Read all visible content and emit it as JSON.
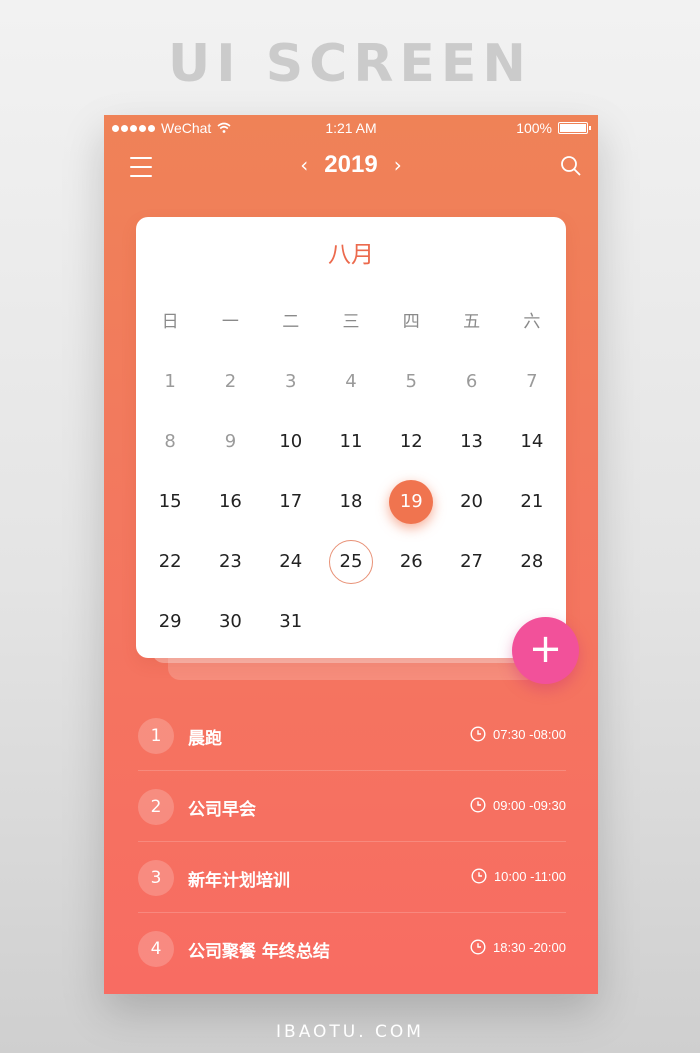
{
  "showcase": {
    "title": "UI SCREEN",
    "footer": "IBAOTU. COM"
  },
  "status_bar": {
    "carrier": "WeChat",
    "time": "1:21 AM",
    "battery": "100%"
  },
  "nav": {
    "year": "2019",
    "prev": "‹",
    "next": "›",
    "icons": [
      "menu-icon",
      "search-icon"
    ]
  },
  "calendar": {
    "month": "八月",
    "weekdays": [
      "日",
      "一",
      "二",
      "三",
      "四",
      "五",
      "六"
    ],
    "days": [
      {
        "d": "1",
        "muted": true
      },
      {
        "d": "2",
        "muted": true
      },
      {
        "d": "3",
        "muted": true
      },
      {
        "d": "4",
        "muted": true
      },
      {
        "d": "5",
        "muted": true
      },
      {
        "d": "6",
        "muted": true
      },
      {
        "d": "7",
        "muted": true
      },
      {
        "d": "8",
        "muted": true
      },
      {
        "d": "9",
        "muted": true
      },
      {
        "d": "10"
      },
      {
        "d": "11"
      },
      {
        "d": "12"
      },
      {
        "d": "13"
      },
      {
        "d": "14"
      },
      {
        "d": "15"
      },
      {
        "d": "16"
      },
      {
        "d": "17"
      },
      {
        "d": "18"
      },
      {
        "d": "19",
        "selected": true
      },
      {
        "d": "20"
      },
      {
        "d": "21"
      },
      {
        "d": "22"
      },
      {
        "d": "23"
      },
      {
        "d": "24"
      },
      {
        "d": "25",
        "ring": true
      },
      {
        "d": "26"
      },
      {
        "d": "27"
      },
      {
        "d": "28"
      },
      {
        "d": "29"
      },
      {
        "d": "30"
      },
      {
        "d": "31"
      }
    ],
    "selected_color": "#f0744f",
    "accent": "#ec6a4d"
  },
  "fab": {
    "label": "+",
    "color": "#f2519a"
  },
  "schedule": [
    {
      "n": "1",
      "title": "晨跑",
      "time": "07:30 -08:00"
    },
    {
      "n": "2",
      "title": "公司早会",
      "time": "09:00 -09:30"
    },
    {
      "n": "3",
      "title": "新年计划培训",
      "time": "10:00 -11:00"
    },
    {
      "n": "4",
      "title": "公司聚餐 年终总结",
      "time": "18:30 -20:00"
    }
  ]
}
